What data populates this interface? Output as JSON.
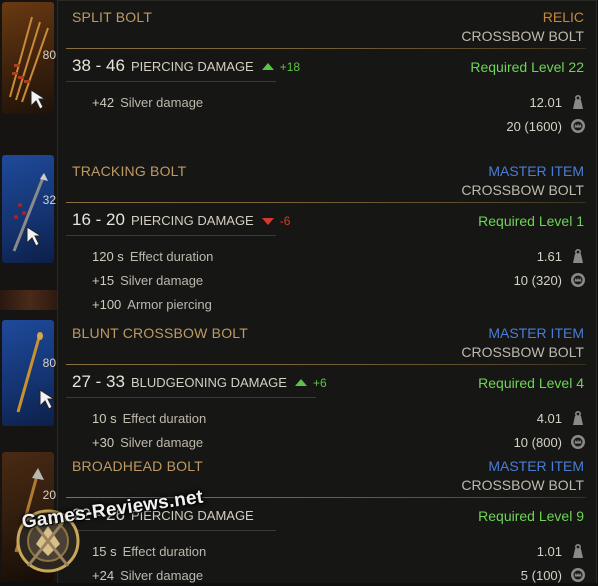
{
  "inventory": {
    "slots": [
      {
        "count": "80"
      },
      {
        "count": "32"
      },
      {
        "count": "80"
      },
      {
        "count": "20"
      }
    ]
  },
  "items": [
    {
      "name": "SPLIT BOLT",
      "rarity": "RELIC",
      "rarity_color": "#c7873c",
      "category": "CROSSBOW BOLT",
      "damage_range": "38 - 46",
      "damage_type": "PIERCING DAMAGE",
      "compare_dir": "up",
      "compare_value": "+18",
      "required_level": "Required Level 22",
      "stats": [
        {
          "value": "+42",
          "label": "Silver damage"
        }
      ],
      "weight": "12.01",
      "price": "20 (1600)"
    },
    {
      "name": "TRACKING BOLT",
      "rarity": "MASTER ITEM",
      "rarity_color": "#4a7dd8",
      "category": "CROSSBOW BOLT",
      "damage_range": "16 - 20",
      "damage_type": "PIERCING DAMAGE",
      "compare_dir": "down",
      "compare_value": "-6",
      "required_level": "Required Level 1",
      "stats": [
        {
          "value": "120 s",
          "label": "Effect duration"
        },
        {
          "value": "+15",
          "label": "Silver damage"
        },
        {
          "value": "+100",
          "label": "Armor piercing"
        }
      ],
      "weight": "1.61",
      "price": "10 (320)"
    },
    {
      "name": "BLUNT CROSSBOW BOLT",
      "rarity": "MASTER ITEM",
      "rarity_color": "#4a7dd8",
      "category": "CROSSBOW BOLT",
      "damage_range": "27 - 33",
      "damage_type": "BLUDGEONING DAMAGE",
      "compare_dir": "up",
      "compare_value": "+6",
      "required_level": "Required Level 4",
      "stats": [
        {
          "value": "10 s",
          "label": "Effect duration"
        },
        {
          "value": "+30",
          "label": "Silver damage"
        }
      ],
      "weight": "4.01",
      "price": "10 (800)"
    },
    {
      "name": "BROADHEAD BOLT",
      "rarity": "MASTER ITEM",
      "rarity_color": "#4a7dd8",
      "category": "CROSSBOW BOLT",
      "damage_range": "22 - 26",
      "damage_type": "PIERCING DAMAGE",
      "compare_dir": "",
      "compare_value": "",
      "required_level": "Required Level 9",
      "stats": [
        {
          "value": "15 s",
          "label": "Effect duration"
        },
        {
          "value": "+24",
          "label": "Silver damage"
        }
      ],
      "weight": "1.01",
      "price": "5 (100)"
    }
  ],
  "icons": {
    "weight": "weight-icon",
    "price": "crown-coin-icon"
  },
  "watermark": "Games-Reviews.net"
}
